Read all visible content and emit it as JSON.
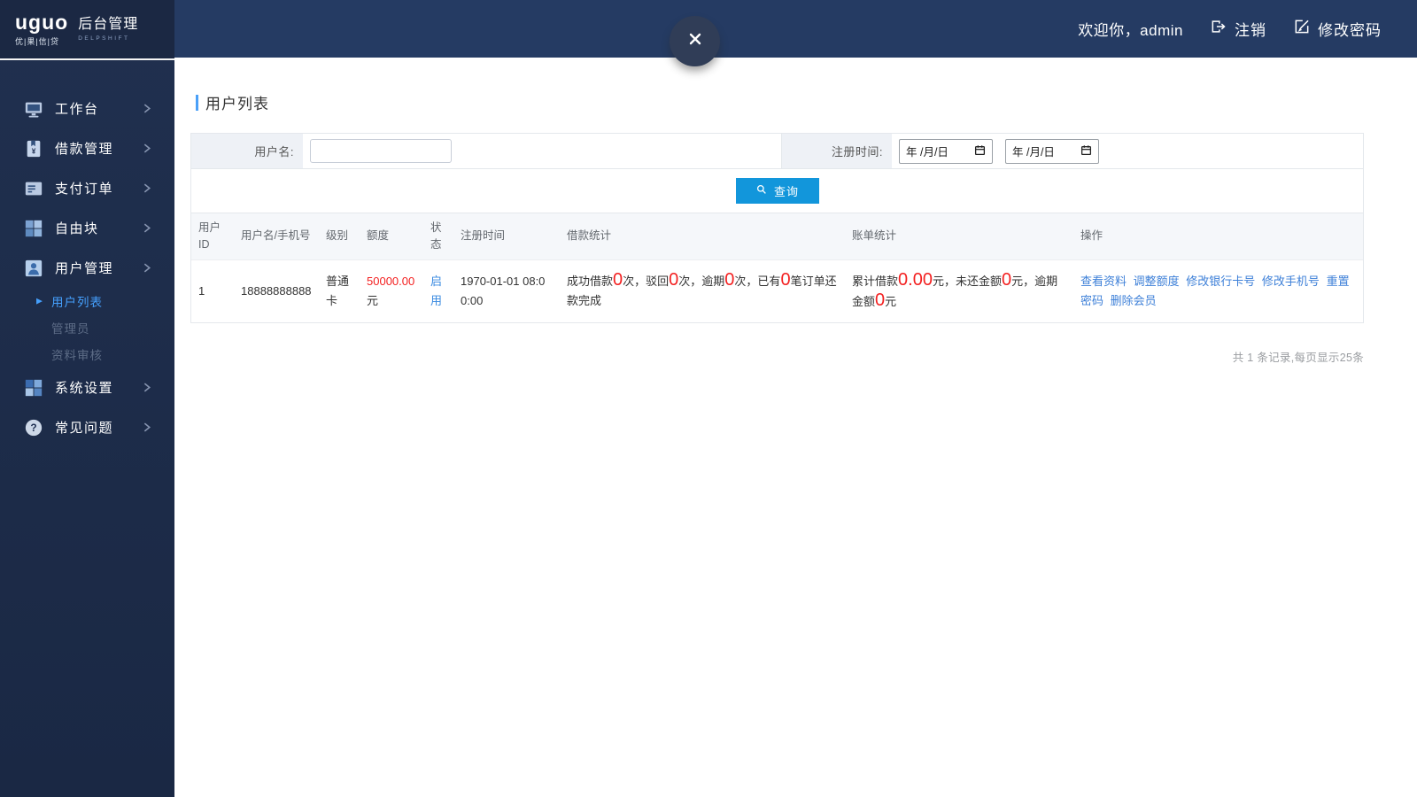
{
  "brand": {
    "name": "uguo",
    "tagline": "优|果|信|贷",
    "title": "后台管理",
    "subtitle": "DELPSHIFT"
  },
  "topbar": {
    "welcome": "欢迎你，admin",
    "logout": "注销",
    "change_password": "修改密码"
  },
  "sidebar": {
    "items": [
      {
        "id": "workbench",
        "label": "工作台",
        "icon": "monitor-icon"
      },
      {
        "id": "loans",
        "label": "借款管理",
        "icon": "loan-icon"
      },
      {
        "id": "payments",
        "label": "支付订单",
        "icon": "payment-icon"
      },
      {
        "id": "blocks",
        "label": "自由块",
        "icon": "blocks-icon"
      },
      {
        "id": "users",
        "label": "用户管理",
        "icon": "users-icon",
        "active": true,
        "children": [
          {
            "id": "user-list",
            "label": "用户列表",
            "active": true
          },
          {
            "id": "admins",
            "label": "管理员"
          },
          {
            "id": "data-review",
            "label": "资料审核"
          }
        ]
      },
      {
        "id": "settings",
        "label": "系统设置",
        "icon": "settings-icon"
      },
      {
        "id": "faq",
        "label": "常见问题",
        "icon": "question-icon"
      }
    ]
  },
  "page": {
    "title": "用户列表",
    "filter": {
      "username_label": "用户名:",
      "username_value": "",
      "register_time_label": "注册时间:",
      "date_placeholder": "年 /月/日",
      "query_label": "查询"
    },
    "table": {
      "headers": [
        "用户ID",
        "用户名/手机号",
        "级别",
        "额度",
        "状态",
        "注册时间",
        "借款统计",
        "账单统计",
        "操作"
      ],
      "row": {
        "id": "1",
        "username": "18888888888",
        "level": "普通卡",
        "quota_amount": "50000.00",
        "quota_unit": "元",
        "status": "启用",
        "register_time": "1970-01-01 08:00:00",
        "borrow_stats": [
          {
            "text": "成功借款"
          },
          {
            "num": "0"
          },
          {
            "text": "次，驳回"
          },
          {
            "num": "0"
          },
          {
            "text": "次，逾期"
          },
          {
            "num": "0"
          },
          {
            "text": "次，已有"
          },
          {
            "num": "0"
          },
          {
            "text": "笔订单还款完成"
          }
        ],
        "bill_stats": [
          {
            "text": "累计借款"
          },
          {
            "num": "0.00"
          },
          {
            "text": "元，未还金额"
          },
          {
            "num": "0"
          },
          {
            "text": "元，逾期金额"
          },
          {
            "num": "0"
          },
          {
            "text": "元"
          }
        ],
        "actions": [
          {
            "id": "view-profile",
            "label": "查看资料"
          },
          {
            "id": "adjust-quota",
            "label": "调整额度"
          },
          {
            "id": "modify-bank-card",
            "label": "修改银行卡号"
          },
          {
            "id": "modify-phone",
            "label": "修改手机号"
          },
          {
            "id": "reset-password",
            "label": "重置密码"
          },
          {
            "id": "delete-member",
            "label": "删除会员"
          }
        ]
      }
    },
    "footer": "共 1 条记录,每页显示25条"
  },
  "colors": {
    "header_bg": "#253b63",
    "sidebar_bg": "#1e2c4c",
    "accent_blue": "#459ffc",
    "link_blue": "#3e80d8",
    "button_blue": "#1296db",
    "danger_red": "#f32121"
  }
}
